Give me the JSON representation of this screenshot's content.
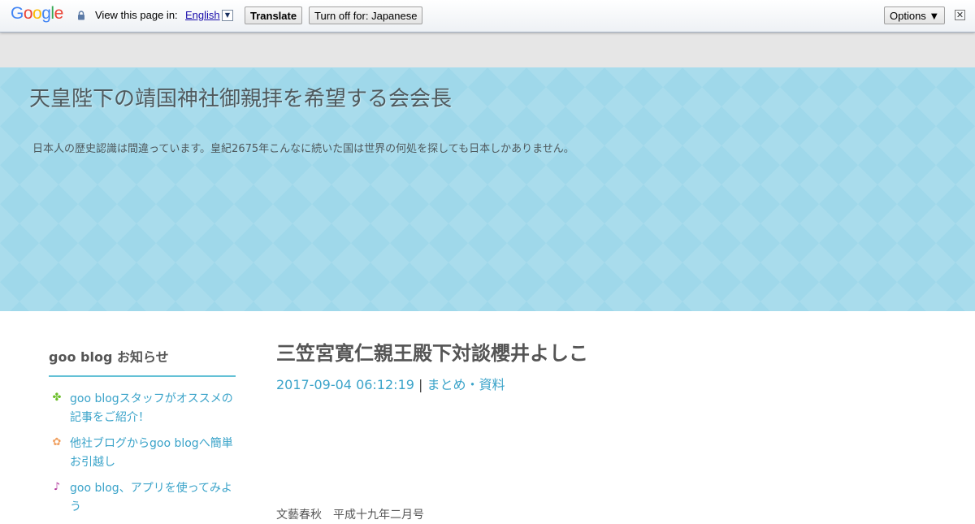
{
  "translate_bar": {
    "logo": "Google",
    "view_text": "View this page in:",
    "language": "English",
    "translate_label": "Translate",
    "turn_off_label": "Turn off for: Japanese",
    "options_label": "Options ▼",
    "close_symbol": "✕"
  },
  "header": {
    "title": "天皇陛下の靖国神社御親拝を希望する会会長",
    "description": "日本人の歴史認識は間違っています。皇紀2675年こんなに続いた国は世界の何処を探しても日本しかありません。"
  },
  "sidebar": {
    "heading": "goo blog お知らせ",
    "items": [
      {
        "icon": "clover-icon",
        "text": "goo blogスタッフがオススメの記事をご紹介！"
      },
      {
        "icon": "flower-icon",
        "text": "他社ブログからgoo blogへ簡単お引越し"
      },
      {
        "icon": "music-note-icon",
        "text": "goo blog、アプリを使ってみよう"
      }
    ]
  },
  "post": {
    "title": "三笠宮寛仁親王殿下対談櫻井よしこ",
    "datetime": "2017-09-04 06:12:19",
    "separator": "|",
    "category": "まとめ・資料",
    "body_cut": "文藝春秋　平成十九年二月号"
  },
  "colors": {
    "header_bg": "#9fd8ea",
    "link": "#3aa3c9",
    "accent_rule": "#64c1d6"
  }
}
